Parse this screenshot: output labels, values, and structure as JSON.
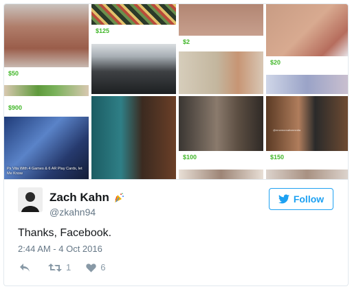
{
  "grid": {
    "prices": [
      "$50",
      "$125",
      "$2",
      "$20",
      "$900",
      "$100",
      "$150"
    ],
    "game_caption": "Ps Vita With 4 Games & 6 AR Play Cards, let Me Know",
    "watermark": "@mrwrecreativemedia"
  },
  "tweet": {
    "display_name": "Zach Kahn",
    "handle": "@zkahn94",
    "follow_label": "Follow",
    "text": "Thanks, Facebook.",
    "timestamp": "2:44 AM - 4 Oct 2016",
    "retweet_count": "1",
    "like_count": "6"
  },
  "colors": {
    "accent": "#1da1f2",
    "price_green": "#42b72a",
    "muted": "#657786"
  },
  "icons": [
    "party-popper-icon",
    "twitter-bird-icon",
    "reply-icon",
    "retweet-icon",
    "heart-icon"
  ]
}
